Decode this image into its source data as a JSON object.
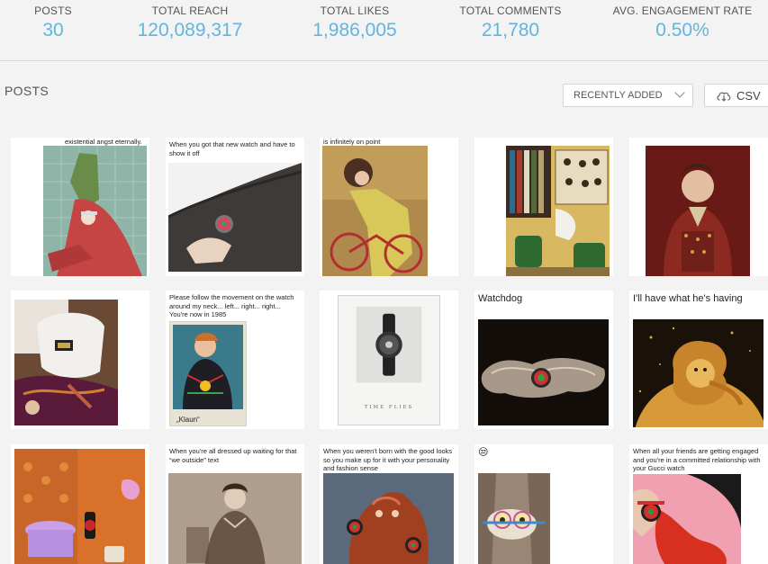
{
  "stats": [
    {
      "label": "POSTS",
      "value": "30"
    },
    {
      "label": "TOTAL REACH",
      "value": "120,089,317"
    },
    {
      "label": "TOTAL LIKES",
      "value": "1,986,005"
    },
    {
      "label": "TOTAL COMMENTS",
      "value": "21,780"
    },
    {
      "label": "AVG. ENGAGEMENT RATE",
      "value": "0.50%"
    }
  ],
  "posts_section": {
    "title": "POSTS",
    "sort_selected": "RECENTLY ADDED",
    "csv_label": "CSV"
  },
  "posts": [
    {
      "caption": "existential angst eternally.",
      "image": "woman in red jacket posing against tile wall"
    },
    {
      "caption": "When you got that new watch and have to show it off",
      "image": "arm in suit sleeve wearing snake watch"
    },
    {
      "caption": "is infinitely on point",
      "image": "woman in yellow suit on red bicycle"
    },
    {
      "caption": "",
      "image": "bookshelf with beetles and green mugs"
    },
    {
      "caption": "",
      "image": "renaissance portrait of man in red"
    },
    {
      "caption": "",
      "image": "person with bag over head holding gucci box"
    },
    {
      "caption": "Please follow the movement on the watch around my neck... left... right... right... You're now in 1985",
      "image": "polaroid of woman in black sweater",
      "inner_label": "„Klaun“"
    },
    {
      "caption": "",
      "image": "gucci bee watch print",
      "inner_label": "TIME FLIES"
    },
    {
      "caption": "Watchdog",
      "image": "furry dog with watch collar"
    },
    {
      "caption": "I'll have what he's having",
      "image": "golden lion with moon"
    },
    {
      "caption": "",
      "image": "retro orange room with purple furniture"
    },
    {
      "caption": "When you're all dressed up waiting for that “we outside” text",
      "image": "vintage sepia photo of woman"
    },
    {
      "caption": "When you weren't born with the good looks so you make up for it with your personality and fashion sense",
      "image": "red furry creature wearing watches"
    },
    {
      "caption": "😒",
      "image": "eye watch on sculpture"
    },
    {
      "caption": "When all your friends are getting engaged and you're in a committed relationship with your Gucci watch",
      "image": "hands with watches and red tongue"
    }
  ],
  "colors": {
    "stat_value": "#62b5dc",
    "background": "#f3f3f3"
  }
}
